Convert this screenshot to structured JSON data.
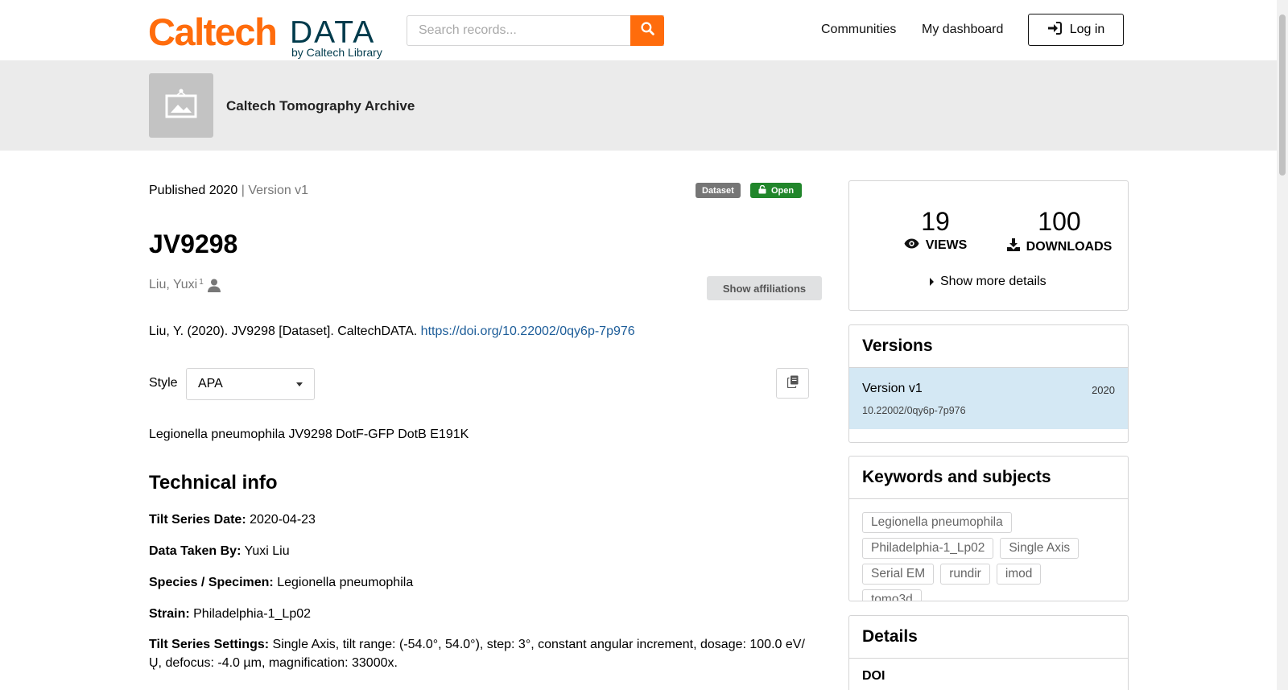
{
  "header": {
    "logo_main": "Caltech",
    "logo_data": "DATA",
    "logo_sub": "by Caltech Library",
    "search_placeholder": "Search records...",
    "nav": [
      "Communities",
      "My dashboard"
    ],
    "login_label": "Log in"
  },
  "community": {
    "name": "Caltech Tomography Archive"
  },
  "record": {
    "published": "Published 2020",
    "version": "| Version v1",
    "badge_type": "Dataset",
    "badge_access": "Open",
    "title": "JV9298",
    "creator": "Liu, Yuxi",
    "creator_affil_num": "1",
    "show_affiliations": "Show affiliations",
    "citation_text": "Liu, Y. (2020). JV9298 [Dataset]. CaltechDATA. ",
    "citation_link": "https://doi.org/10.22002/0qy6p-7p976",
    "style_label": "Style",
    "style_value": "APA",
    "description": "Legionella pneumophila JV9298 DotF-GFP DotB E191K",
    "technical_heading": "Technical info",
    "technical": [
      {
        "label": "Tilt Series Date:",
        "value": "2020-04-23"
      },
      {
        "label": "Data Taken By:",
        "value": "Yuxi Liu"
      },
      {
        "label": "Species / Specimen:",
        "value": "Legionella pneumophila"
      },
      {
        "label": "Strain:",
        "value": "Philadelphia-1_Lp02"
      },
      {
        "label": "Tilt Series Settings:",
        "value": "Single Axis, tilt range: (-54.0°, 54.0°), step: 3°, constant angular increment, dosage: 100.0 eV/Ų, defocus: -4.0 µm, magnification: 33000x."
      }
    ]
  },
  "sidebar": {
    "views_count": "19",
    "views_label": "VIEWS",
    "downloads_count": "100",
    "downloads_label": "DOWNLOADS",
    "show_more": "Show more details",
    "versions_title": "Versions",
    "version_name": "Version v1",
    "version_year": "2020",
    "version_doi": "10.22002/0qy6p-7p976",
    "keywords_title": "Keywords and subjects",
    "keywords": [
      "Legionella pneumophila",
      "Philadelphia-1_Lp02",
      "Single Axis",
      "Serial EM",
      "rundir",
      "imod",
      "tomo3d"
    ],
    "details_title": "Details",
    "details_doi_label": "DOI"
  },
  "colors": {
    "brand_orange": "#ff6c0c",
    "brand_navy": "#003b4c",
    "open_green": "#21862b",
    "link_blue": "#1d5d99",
    "version_highlight": "#d4e8f4"
  }
}
